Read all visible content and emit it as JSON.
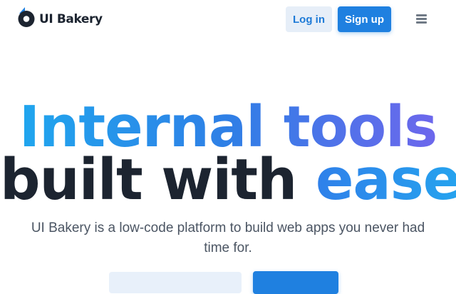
{
  "brand": {
    "name": "UI Bakery"
  },
  "header": {
    "login_label": "Log in",
    "signup_label": "Sign up",
    "menu_icon": "hamburger-menu-icon"
  },
  "hero": {
    "line1_word1": "Internal",
    "line1_word2": "tools",
    "line2_part1": "built with",
    "line2_part2": "ease",
    "subtitle": "UI Bakery is a low-code platform to build web apps you never had time for."
  },
  "colors": {
    "accent_blue": "#1f80e0",
    "gradient_start": "#20a6ee",
    "gradient_end": "#6d67ec",
    "heading_dark": "#1c2430"
  }
}
